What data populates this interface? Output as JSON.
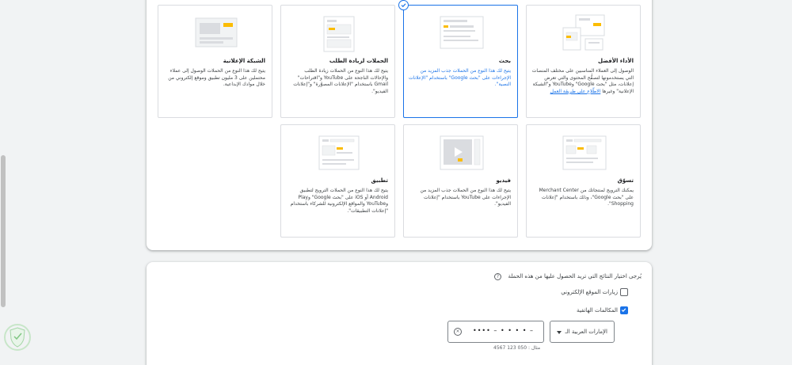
{
  "campaign_types": {
    "display": {
      "title": "الشبكة الإعلانية",
      "desc": "يتيح لك هذا النوع من الحملات الوصول إلى عملاء محتملين على 3 مليون تطبيق وموقع إلكتروني من خلال موادك الإبداعية."
    },
    "demand_gen": {
      "title": "الحملات لزيادة الطلب",
      "desc": "يتيح لك هذا النوع من الحملات زيادة الطلب والإحالات الناجحة على YouTube و\"اقتراحات\" Gmail باستخدام \"الإعلانات المصوَّرة\" و\"إعلانات الفيديو\"."
    },
    "search": {
      "title": "بحث",
      "desc": "يتيح لك هذا النوع من الحملات جذب المزيد من الإجراءات على \"بحث Google\" باستخدام \"الإعلانات النصية\"."
    },
    "performance_max": {
      "title": "الأداء الأفضل",
      "desc": "الوصول إلى العملاء المناسبين على مختلف المنصات التي يستخدمونها لتصفُّح المحتوى والتي تعرض إعلانات، مثل \"بحث Google\" وYouTube و\"الشبكة الإعلانية\" وغيرها",
      "link": "الاطّلاع على طريقة العمل"
    },
    "app": {
      "title": "تطبيق",
      "desc": "يتيح لك هذا النوع من الحملات الترويج لتطبيق Android أو iOS على \"بحث Google\" وPlay وYouTube والمواقع الإلكترونية للشركاء باستخدام \"إعلانات التطبيقات\"."
    },
    "video": {
      "title": "فيديو",
      "desc": "يتيح لك هذا النوع من الحملات جذب المزيد من الإجراءات على YouTube باستخدام \"إعلانات الفيديو\"."
    },
    "shopping": {
      "title": "تسوّق",
      "desc": "يمكنك الترويج لمنتجاتك من Merchant Center على \"بحث Google\"، وذلك باستخدام \"إعلانات Shopping\"."
    }
  },
  "goals": {
    "title": "يُرجى اختيار النتائج التي تريد الحصول عليها من هذه الحملة",
    "help_icon": "?",
    "website_visits": "زيارات الموقع الإلكتروني",
    "phone_calls": "المكالمات الهاتفية",
    "country_value": "الإمارات العربية الـ",
    "phone_value": "•••• – • • • • –",
    "example": "مثال : 050 123 4567"
  },
  "colors": {
    "accent": "#1a73e8",
    "yellow": "#fbbc04",
    "border": "#dadce0"
  }
}
